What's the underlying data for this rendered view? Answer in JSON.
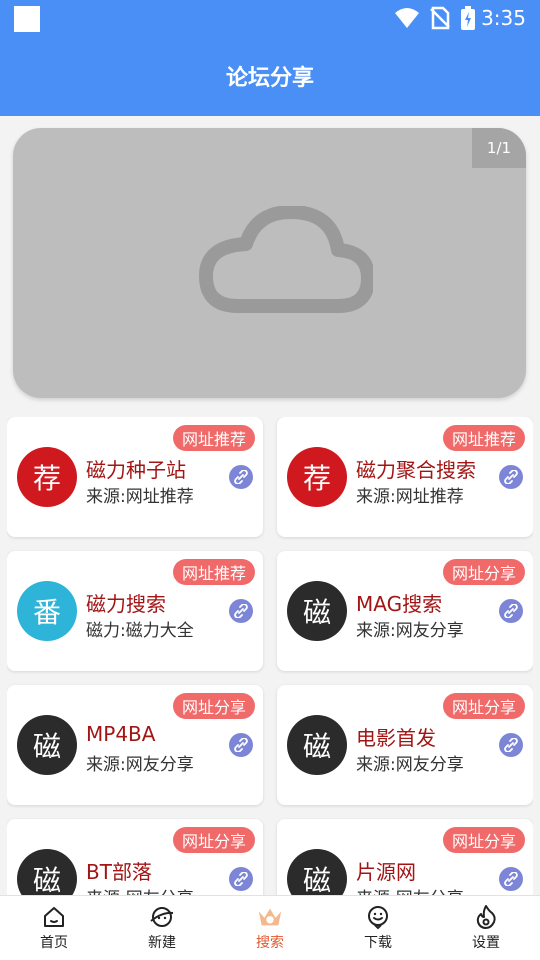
{
  "status_bar": {
    "time": "3:35"
  },
  "header": {
    "title": "论坛分享"
  },
  "banner": {
    "counter": "1/1",
    "icon": "cloud-icon"
  },
  "cards": [
    {
      "tag": "网址推荐",
      "avatar_char": "荐",
      "avatar_color": "#d0191f",
      "title": "磁力种子站",
      "subtitle": "来源:网址推荐"
    },
    {
      "tag": "网址推荐",
      "avatar_char": "荐",
      "avatar_color": "#d0191f",
      "title": "磁力聚合搜索",
      "subtitle": "来源:网址推荐"
    },
    {
      "tag": "网址推荐",
      "avatar_char": "番",
      "avatar_color": "#2db4d8",
      "title": "磁力搜索",
      "subtitle": "磁力:磁力大全"
    },
    {
      "tag": "网址分享",
      "avatar_char": "磁",
      "avatar_color": "#2b2b2b",
      "title": "MAG搜索",
      "subtitle": "来源:网友分享"
    },
    {
      "tag": "网址分享",
      "avatar_char": "磁",
      "avatar_color": "#2b2b2b",
      "title": "MP4BA",
      "subtitle": "来源:网友分享"
    },
    {
      "tag": "网址分享",
      "avatar_char": "磁",
      "avatar_color": "#2b2b2b",
      "title": "电影首发",
      "subtitle": "来源:网友分享"
    },
    {
      "tag": "网址分享",
      "avatar_char": "磁",
      "avatar_color": "#2b2b2b",
      "title": "BT部落",
      "subtitle": "来源:网友分享"
    },
    {
      "tag": "网址分享",
      "avatar_char": "磁",
      "avatar_color": "#2b2b2b",
      "title": "片源网",
      "subtitle": "来源:网友分享"
    }
  ],
  "bottom_nav": [
    {
      "label": "首页",
      "icon": "home-icon",
      "active": false
    },
    {
      "label": "新建",
      "icon": "planet-icon",
      "active": false
    },
    {
      "label": "搜索",
      "icon": "crown-icon",
      "active": true
    },
    {
      "label": "下载",
      "icon": "smile-icon",
      "active": false
    },
    {
      "label": "设置",
      "icon": "flame-icon",
      "active": false
    }
  ],
  "colors": {
    "primary": "#4a8ff5",
    "tag": "#f06a6a",
    "title": "#a31515",
    "active_nav": "#e05a2f",
    "link_icon": "#7d86d6"
  }
}
